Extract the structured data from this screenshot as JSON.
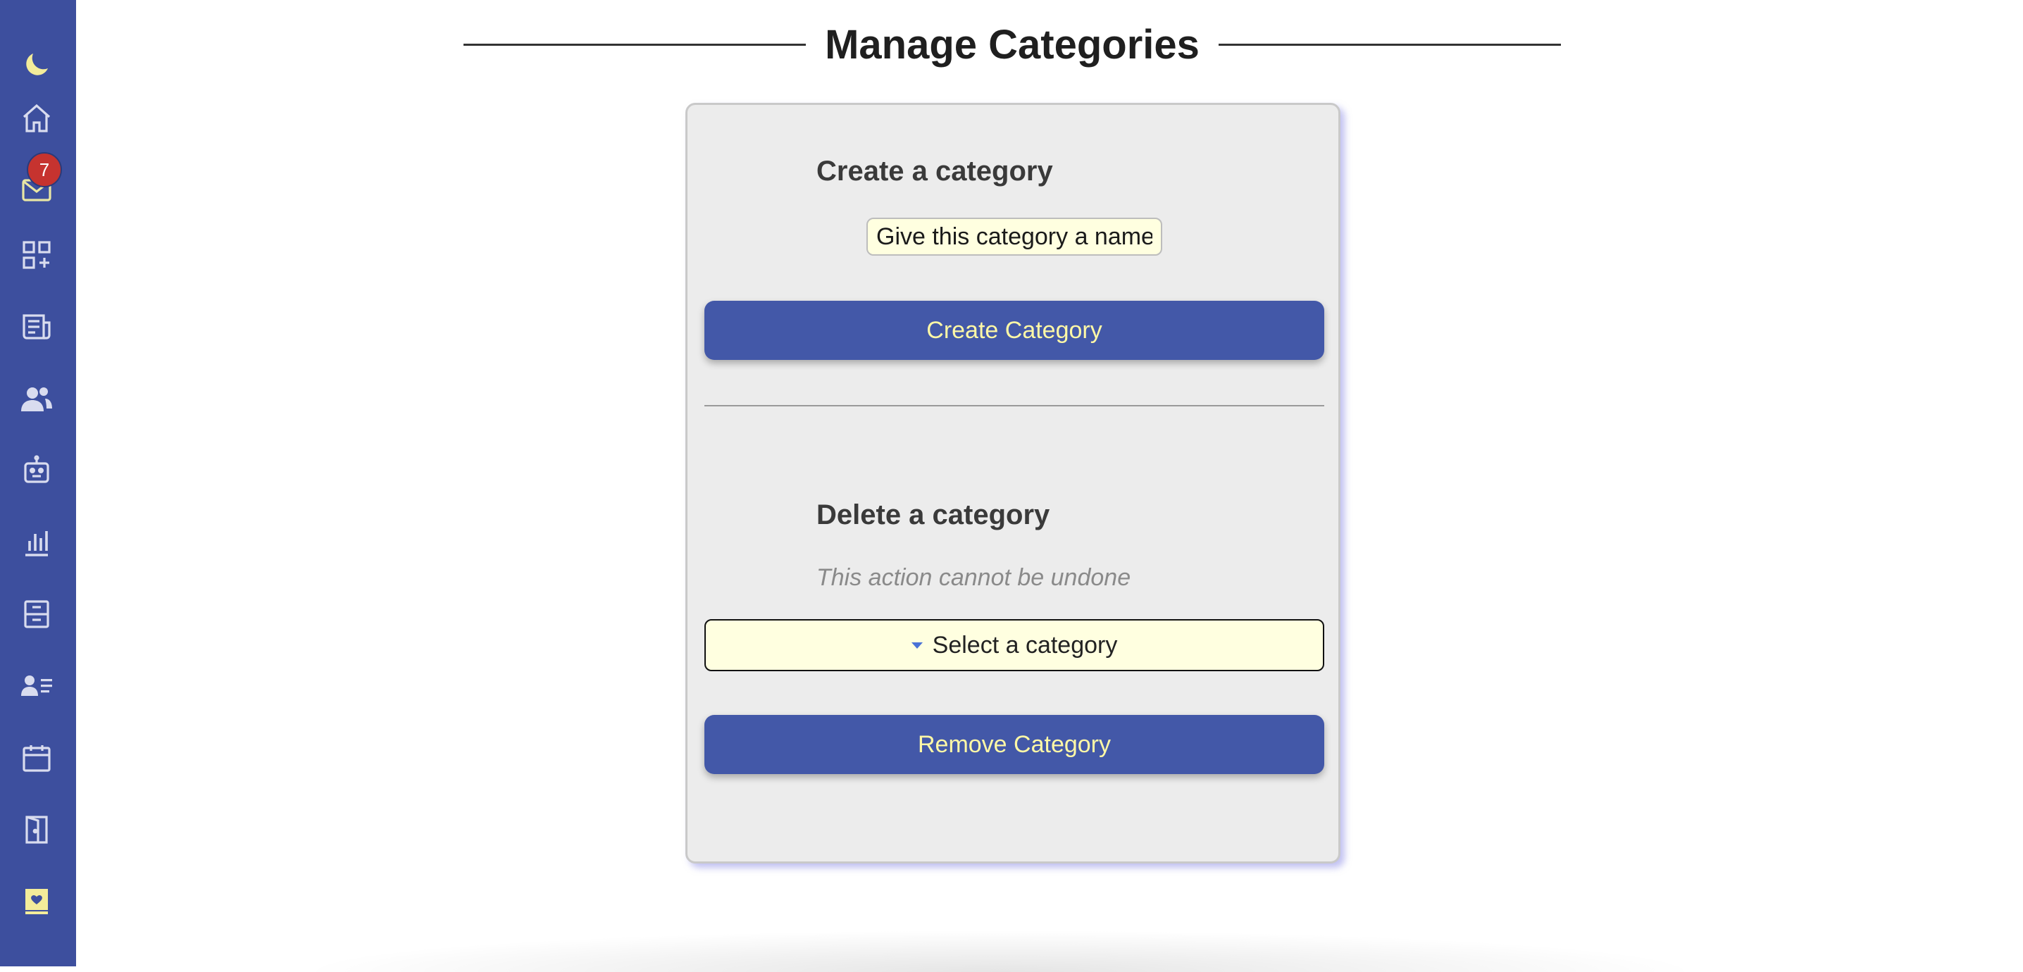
{
  "page": {
    "title": "Manage Categories"
  },
  "sidebar": {
    "background": "#3d4f9e",
    "icon_color": "#e9e6a4",
    "items": [
      {
        "icon": "moon-icon"
      },
      {
        "icon": "home-icon"
      },
      {
        "icon": "mail-icon",
        "badge": "7"
      },
      {
        "icon": "apps-add-icon"
      },
      {
        "icon": "newspaper-icon"
      },
      {
        "icon": "users-icon"
      },
      {
        "icon": "robot-icon"
      },
      {
        "icon": "bar-chart-icon"
      },
      {
        "icon": "archive-icon"
      },
      {
        "icon": "user-list-icon"
      },
      {
        "icon": "calendar-icon"
      },
      {
        "icon": "door-exit-icon"
      },
      {
        "icon": "heart-book-icon"
      }
    ]
  },
  "create_section": {
    "heading": "Create a category",
    "input_placeholder": "Give this category a name",
    "button_label": "Create Category"
  },
  "delete_section": {
    "heading": "Delete a category",
    "warning": "This action cannot be undone",
    "select_value": "Select a category",
    "button_label": "Remove Category"
  },
  "colors": {
    "button_bg": "#4358a8",
    "button_text": "#fff8a6",
    "input_bg": "#ffffe0",
    "badge_bg": "#c6332f"
  }
}
